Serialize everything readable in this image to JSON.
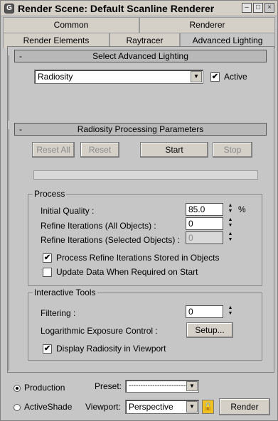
{
  "window": {
    "title": "Render Scene: Default Scanline Renderer"
  },
  "tabs_row1": [
    "Common",
    "Renderer"
  ],
  "tabs_row2": [
    "Render Elements",
    "Raytracer",
    "Advanced Lighting"
  ],
  "select_rollout": {
    "title": "Select Advanced Lighting",
    "collapse": "-",
    "plugin_value": "Radiosity",
    "active_label": "Active",
    "active_checked": true
  },
  "radiosity_rollout": {
    "title": "Radiosity Processing Parameters",
    "collapse": "-",
    "reset_all": "Reset All",
    "reset": "Reset",
    "start": "Start",
    "stop": "Stop",
    "progress": 0
  },
  "process_group": {
    "title": "Process",
    "initial_quality_label": "Initial Quality :",
    "initial_quality_value": "85.0",
    "percent": "%",
    "refine_all_label": "Refine Iterations (All Objects) :",
    "refine_all_value": "0",
    "refine_selected_label": "Refine Iterations (Selected Objects) :",
    "refine_selected_value": "0",
    "process_refine_label": "Process Refine Iterations Stored in Objects",
    "process_refine_checked": true,
    "update_data_label": "Update Data When Required on Start",
    "update_data_checked": false
  },
  "interactive_group": {
    "title": "Interactive Tools",
    "filtering_label": "Filtering :",
    "filtering_value": "0",
    "exposure_label": "Logarithmic Exposure Control :",
    "setup_button": "Setup...",
    "display_label": "Display Radiosity in Viewport",
    "display_checked": true
  },
  "footer": {
    "production_label": "Production",
    "activeshade_label": "ActiveShade",
    "mode_selected": "Production",
    "preset_label": "Preset:",
    "preset_value": "-------------------------",
    "viewport_label": "Viewport:",
    "viewport_value": "Perspective",
    "render_button": "Render"
  },
  "icons": {
    "app": "max-logo-icon",
    "dropdown": "chevron-down-icon",
    "lock": "lock-icon",
    "spinner": "spinner-arrows-icon"
  }
}
